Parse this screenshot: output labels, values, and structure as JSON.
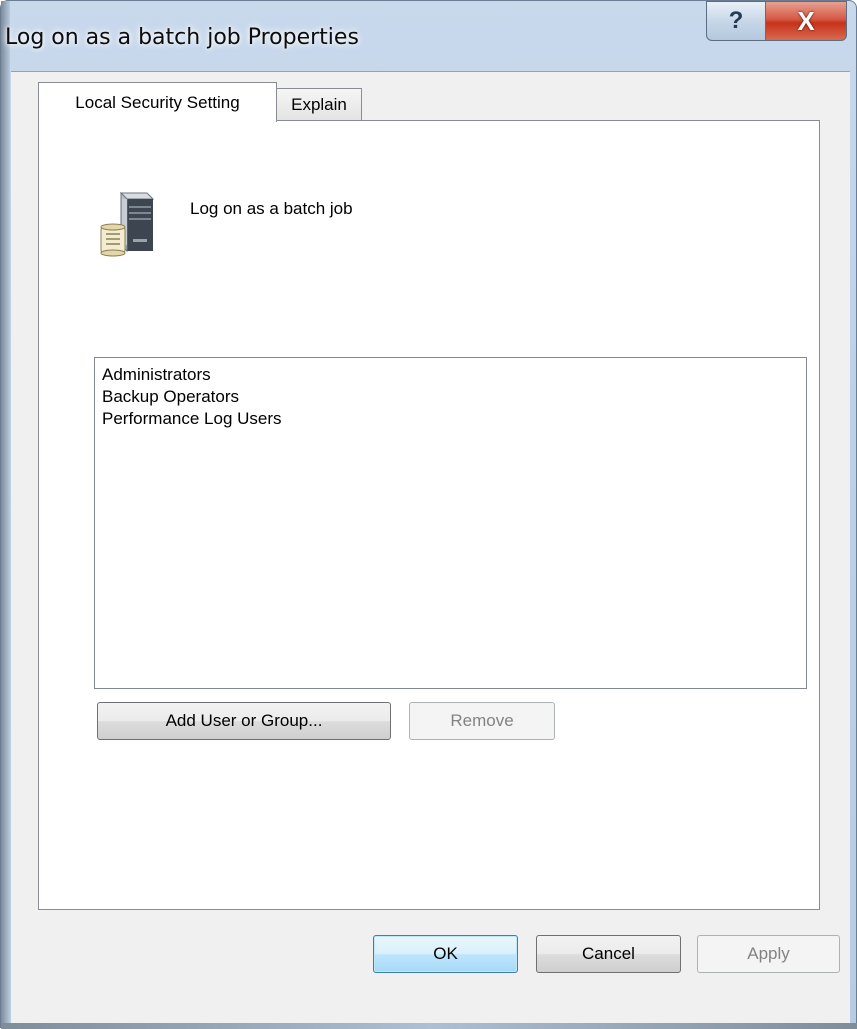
{
  "window": {
    "title": "Log on as a batch job Properties",
    "help_glyph": "?",
    "close_glyph": "X"
  },
  "tabs": [
    {
      "label": "Local Security Setting",
      "selected": true
    },
    {
      "label": "Explain",
      "selected": false
    }
  ],
  "policy": {
    "icon": "server-policy-icon",
    "title": "Log on as a batch job"
  },
  "accounts": [
    "Administrators",
    "Backup Operators",
    "Performance Log Users"
  ],
  "buttons": {
    "add": "Add User or Group...",
    "remove": "Remove",
    "ok": "OK",
    "cancel": "Cancel",
    "apply": "Apply"
  },
  "colors": {
    "close_button": "#c7321b",
    "default_button_border": "#3c7fb1",
    "disabled_text": "#838383"
  }
}
